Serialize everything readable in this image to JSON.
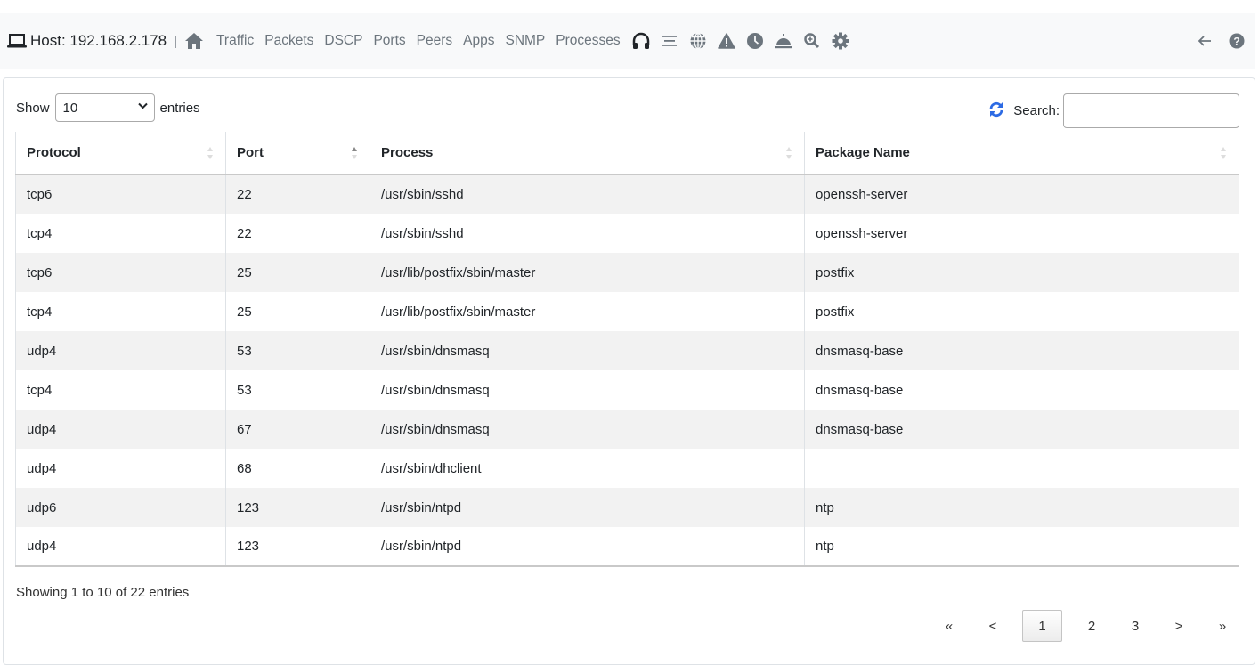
{
  "navbar": {
    "host_label": "Host: 192.168.2.178",
    "separator": "|",
    "links": [
      "Traffic",
      "Packets",
      "DSCP",
      "Ports",
      "Peers",
      "Apps",
      "SNMP",
      "Processes"
    ],
    "icons": [
      "headphones-icon",
      "list-icon",
      "globe-icon",
      "warning-icon",
      "clock-icon",
      "bell-icon",
      "zoom-icon",
      "gear-icon"
    ],
    "right_icons": [
      "back-arrow-icon",
      "help-icon"
    ]
  },
  "controls": {
    "show_label": "Show",
    "entries_label": "entries",
    "page_length": "10",
    "search_label": "Search:",
    "search_value": "",
    "accent_color": "#2d6be4"
  },
  "table": {
    "columns": [
      "Protocol",
      "Port",
      "Process",
      "Package Name"
    ],
    "sorted_column": "Port",
    "sort_direction": "ascending",
    "rows": [
      [
        "tcp6",
        "22",
        "/usr/sbin/sshd",
        "openssh-server"
      ],
      [
        "tcp4",
        "22",
        "/usr/sbin/sshd",
        "openssh-server"
      ],
      [
        "tcp6",
        "25",
        "/usr/lib/postfix/sbin/master",
        "postfix"
      ],
      [
        "tcp4",
        "25",
        "/usr/lib/postfix/sbin/master",
        "postfix"
      ],
      [
        "udp4",
        "53",
        "/usr/sbin/dnsmasq",
        "dnsmasq-base"
      ],
      [
        "tcp4",
        "53",
        "/usr/sbin/dnsmasq",
        "dnsmasq-base"
      ],
      [
        "udp4",
        "67",
        "/usr/sbin/dnsmasq",
        "dnsmasq-base"
      ],
      [
        "udp4",
        "68",
        "/usr/sbin/dhclient",
        ""
      ],
      [
        "udp6",
        "123",
        "/usr/sbin/ntpd",
        "ntp"
      ],
      [
        "udp4",
        "123",
        "/usr/sbin/ntpd",
        "ntp"
      ]
    ]
  },
  "footer": {
    "info": "Showing 1 to 10 of 22 entries",
    "pagination": {
      "first": "«",
      "prev": "<",
      "pages": [
        "1",
        "2",
        "3"
      ],
      "current": "1",
      "next": ">",
      "last": "»"
    }
  }
}
